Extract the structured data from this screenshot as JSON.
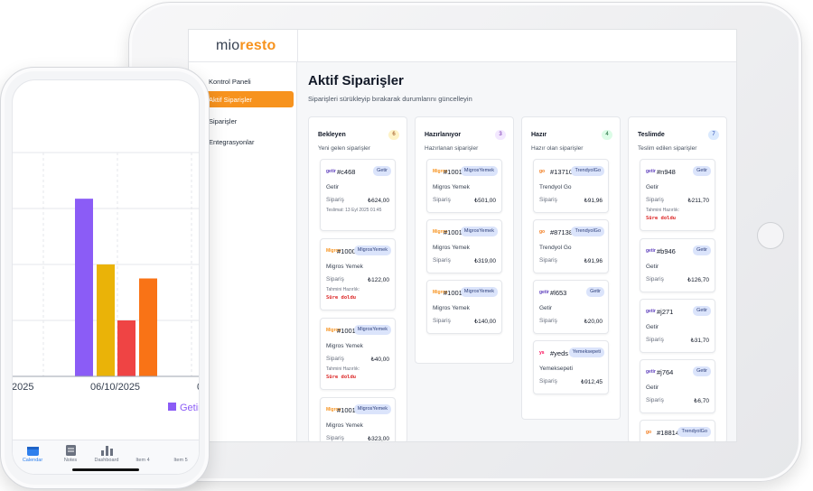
{
  "app": {
    "logo_a": "mio",
    "logo_b": "resto"
  },
  "sidebar": {
    "items": [
      {
        "label": "Kontrol Paneli",
        "active": false
      },
      {
        "label": "Aktif Siparişler",
        "active": true
      },
      {
        "label": "Siparişler",
        "active": false
      },
      {
        "label": "Entegrasyonlar",
        "active": false
      }
    ]
  },
  "page": {
    "title": "Aktif Siparişler",
    "subtitle": "Siparişleri sürükleyip bırakarak durumlarını güncelleyin"
  },
  "columns": [
    {
      "title": "Bekleyen",
      "subtitle": "Yeni gelen siparişler",
      "count": "6",
      "count_bg": "#fef3c7",
      "count_fg": "#92400e",
      "cards": [
        {
          "logo": "getir",
          "id": "#c468",
          "platform": "Getir",
          "name": "Getir",
          "label": "Sipariş",
          "amount": "₺624,00",
          "extra": "Teslimat: 13 Eyl 2025 01:45",
          "due": ""
        },
        {
          "logo": "migros",
          "id": "#1000697",
          "platform": "MigrosYemek",
          "name": "Migros Yemek",
          "label": "Sipariş",
          "amount": "₺122,00",
          "extra": "Tahmini Hazırlık:",
          "due": "Süre doldu"
        },
        {
          "logo": "migros",
          "id": "#100198",
          "platform": "MigrosYemek",
          "name": "Migros Yemek",
          "label": "Sipariş",
          "amount": "₺40,00",
          "extra": "Tahmini Hazırlık:",
          "due": "Süre doldu"
        },
        {
          "logo": "migros",
          "id": "#100199",
          "platform": "MigrosYemek",
          "name": "Migros Yemek",
          "label": "Sipariş",
          "amount": "₺323,00",
          "extra": "",
          "due": ""
        }
      ]
    },
    {
      "title": "Hazırlanıyor",
      "subtitle": "Hazırlanan siparişler",
      "count": "3",
      "count_bg": "#f3e8ff",
      "count_fg": "#6b21a8",
      "cards": [
        {
          "logo": "migros",
          "id": "#100199",
          "platform": "MigrosYemek",
          "name": "Migros Yemek",
          "label": "Sipariş",
          "amount": "₺501,00",
          "extra": "",
          "due": ""
        },
        {
          "logo": "migros",
          "id": "#100199",
          "platform": "MigrosYemek",
          "name": "Migros Yemek",
          "label": "Sipariş",
          "amount": "₺319,00",
          "extra": "",
          "due": ""
        },
        {
          "logo": "migros",
          "id": "#100199",
          "platform": "MigrosYemek",
          "name": "Migros Yemek",
          "label": "Sipariş",
          "amount": "₺140,00",
          "extra": "",
          "due": ""
        }
      ]
    },
    {
      "title": "Hazır",
      "subtitle": "Hazır olan siparişler",
      "count": "4",
      "count_bg": "#dcfce7",
      "count_fg": "#166534",
      "cards": [
        {
          "logo": "trendyol",
          "id": "#137109",
          "platform": "TrendyolGo",
          "name": "Trendyol Go",
          "label": "Sipariş",
          "amount": "₺91,96",
          "extra": "",
          "due": ""
        },
        {
          "logo": "trendyol",
          "id": "#871383",
          "platform": "TrendyolGo",
          "name": "Trendyol Go",
          "label": "Sipariş",
          "amount": "₺91,96",
          "extra": "",
          "due": ""
        },
        {
          "logo": "getir",
          "id": "#l653",
          "platform": "Getir",
          "name": "Getir",
          "label": "Sipariş",
          "amount": "₺20,00",
          "extra": "",
          "due": ""
        },
        {
          "logo": "yemeksepeti",
          "id": "#yeds b0j6",
          "platform": "Yemeksepeti",
          "name": "Yemeksepeti",
          "label": "Sipariş",
          "amount": "₺912,45",
          "extra": "",
          "due": ""
        }
      ]
    },
    {
      "title": "Teslimde",
      "subtitle": "Teslim edilen siparişler",
      "count": "7",
      "count_bg": "#dbeafe",
      "count_fg": "#1e40af",
      "cards": [
        {
          "logo": "getir",
          "id": "#n948",
          "platform": "Getir",
          "name": "Getir",
          "label": "Sipariş",
          "amount": "₺211,70",
          "extra": "Tahmini Hazırlık:",
          "due": "Süre doldu"
        },
        {
          "logo": "getir",
          "id": "#b946",
          "platform": "Getir",
          "name": "Getir",
          "label": "Sipariş",
          "amount": "₺126,70",
          "extra": "",
          "due": ""
        },
        {
          "logo": "getir",
          "id": "#j271",
          "platform": "Getir",
          "name": "Getir",
          "label": "Sipariş",
          "amount": "₺31,70",
          "extra": "",
          "due": ""
        },
        {
          "logo": "getir",
          "id": "#j764",
          "platform": "Getir",
          "name": "Getir",
          "label": "Sipariş",
          "amount": "₺6,70",
          "extra": "",
          "due": ""
        },
        {
          "logo": "trendyol",
          "id": "#188144",
          "platform": "TrendyolGo",
          "name": "Trendyol Go",
          "label": "Sipariş",
          "amount": "",
          "extra": "",
          "due": ""
        }
      ]
    }
  ],
  "colors": {
    "accent": "#f7931e",
    "getir": "#5d3ebc",
    "migros": "#f7931e",
    "trendyol": "#f27a1a",
    "yemeksepeti": "#fa0050"
  },
  "phone": {
    "chart_data": {
      "type": "bar",
      "categories": [
        "/2025",
        "06/10/2025",
        "0"
      ],
      "series": [
        {
          "name": "Getir",
          "color": "#8b5cf6",
          "values": [
            1.27
          ]
        },
        {
          "name": "",
          "color": "#eab308",
          "values": [
            0.8
          ]
        },
        {
          "name": "",
          "color": "#ef4444",
          "values": [
            0.4
          ]
        },
        {
          "name": "",
          "color": "#f97316",
          "values": [
            0.7
          ]
        }
      ],
      "ylim": [
        0,
        1.6
      ],
      "legend": "bottom",
      "grid": true
    },
    "tabs": [
      {
        "label": "Calendar",
        "icon": "calendar-icon",
        "active": true
      },
      {
        "label": "Notes",
        "icon": "notes-icon",
        "active": false
      },
      {
        "label": "Dashboard",
        "icon": "dashboard-icon",
        "active": false
      },
      {
        "label": "Item 4",
        "icon": "",
        "active": false
      },
      {
        "label": "Item 5",
        "icon": "",
        "active": false
      }
    ]
  }
}
